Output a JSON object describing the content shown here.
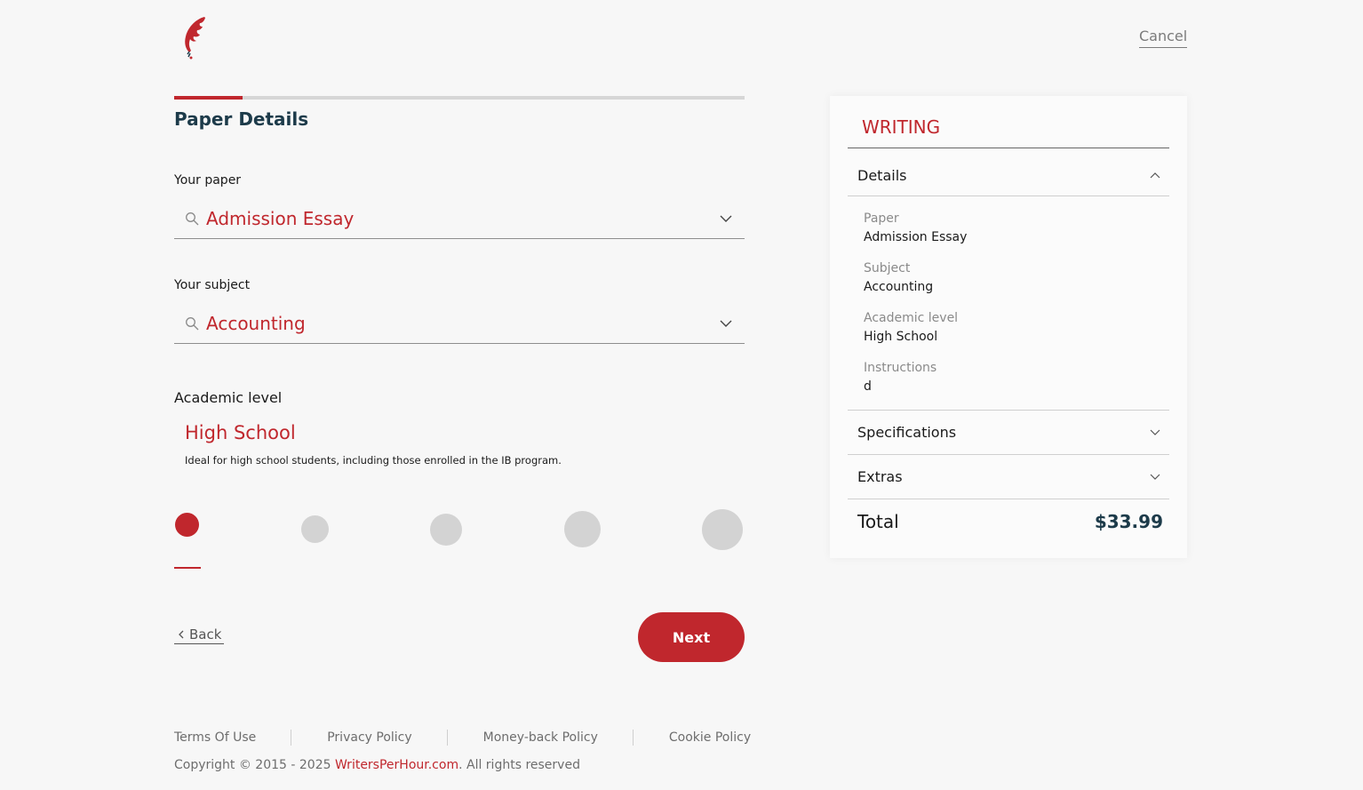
{
  "header": {
    "logo": "feather-logo",
    "cancel_label": "Cancel"
  },
  "progress": {
    "fraction": 0.12
  },
  "page_title": "Paper Details",
  "form": {
    "paper": {
      "label": "Your paper",
      "value": "Admission Essay"
    },
    "subject": {
      "label": "Your subject",
      "value": "Accounting"
    },
    "academic_level": {
      "label": "Academic level",
      "selected_title": "High School",
      "description": "Ideal for high school students, including those enrolled in the IB program.",
      "levels_count": 5,
      "selected_index": 0
    }
  },
  "nav": {
    "back_label": "Back",
    "next_label": "Next"
  },
  "footer": {
    "links": [
      "Terms Of Use",
      "Privacy Policy",
      "Money-back Policy",
      "Cookie Policy"
    ],
    "copyright_prefix": "Copyright © 2015 - 2025 ",
    "copyright_site": "WritersPerHour.com",
    "copyright_suffix": ". All rights reserved"
  },
  "summary": {
    "heading": "WRITING",
    "details_label": "Details",
    "details": [
      {
        "key": "Paper",
        "value": "Admission Essay"
      },
      {
        "key": "Subject",
        "value": "Accounting"
      },
      {
        "key": "Academic level",
        "value": "High School"
      },
      {
        "key": "Instructions",
        "value": "d"
      }
    ],
    "specifications_label": "Specifications",
    "extras_label": "Extras",
    "total_label": "Total",
    "total_value": "$33.99"
  },
  "colors": {
    "accent": "#c0272d",
    "dark": "#1d3b4a",
    "inactive_dot": "#d3d3d3"
  }
}
